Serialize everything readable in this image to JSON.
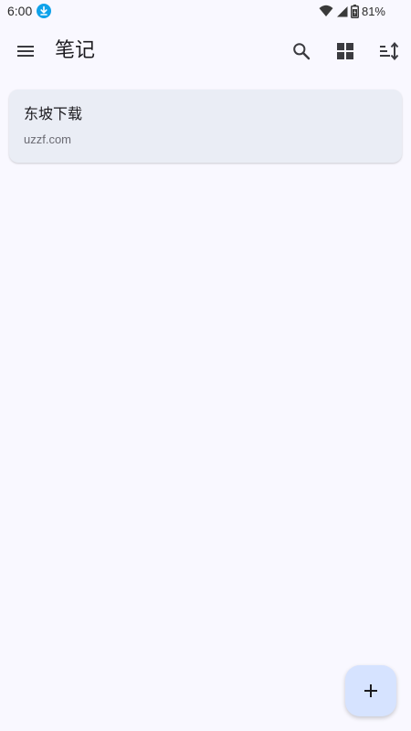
{
  "status_bar": {
    "time": "6:00",
    "battery": "81%",
    "icons": [
      "download-icon",
      "wifi-icon",
      "signal-icon",
      "battery-icon"
    ]
  },
  "app_bar": {
    "title": "笔记",
    "icons": [
      "menu-icon",
      "search-icon",
      "grid-view-icon",
      "sort-icon"
    ]
  },
  "notes": [
    {
      "title": "东坡下载",
      "body": "uzzf.com"
    }
  ],
  "fab": {
    "icon": "plus-icon"
  },
  "colors": {
    "background": "#f9f8ff",
    "card": "#eaedf5",
    "fab": "#d6e3ff",
    "download_badge": "#0fa2ea"
  }
}
